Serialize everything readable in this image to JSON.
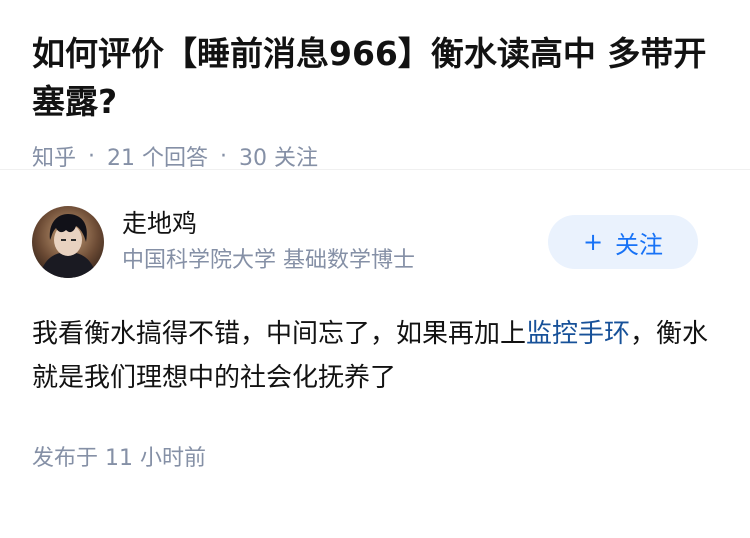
{
  "question": {
    "title": "如何评价【睡前消息966】衡水读高中 多带开塞露?",
    "source": "知乎",
    "answers_count": "21 个回答",
    "followers_count": "30 关注"
  },
  "answer": {
    "author": {
      "name": "走地鸡",
      "bio": "中国科学院大学 基础数学博士",
      "avatar_icon": "user-avatar"
    },
    "follow_button": {
      "icon": "plus-icon",
      "plus_glyph": "+",
      "label": "关注"
    },
    "content": {
      "text_before": "我看衡水搞得不错，中间忘了，如果再加上",
      "link_text": "监控手环",
      "text_after": "，衡水就是我们理想中的社会化抚养了"
    },
    "post_time": "发布于 11 小时前"
  },
  "colors": {
    "link": "#175199",
    "meta": "#8590a6",
    "follow_bg": "#eaf2fd",
    "follow_text": "#1772f6"
  }
}
